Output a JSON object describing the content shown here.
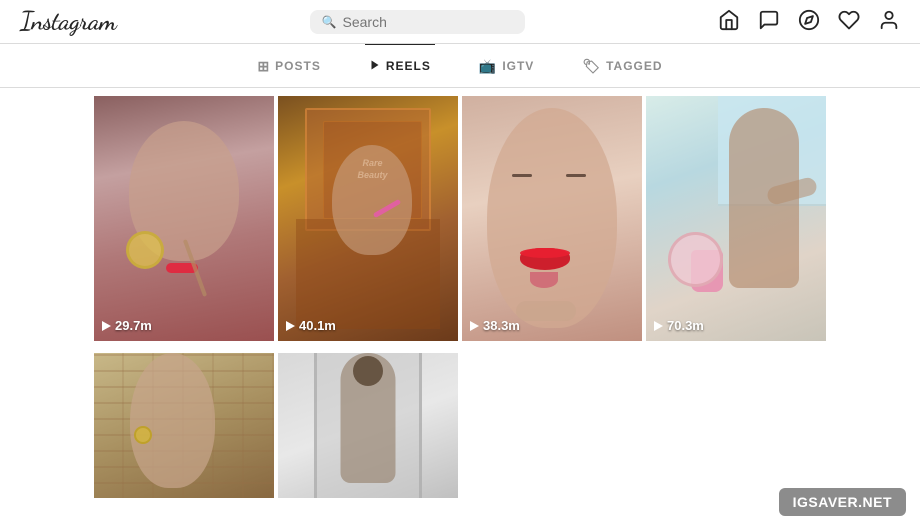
{
  "header": {
    "logo": "Instagram",
    "search": {
      "placeholder": "Search"
    },
    "nav": {
      "home": "🏠",
      "messenger": "💬",
      "compass": "🧭",
      "heart": "♡",
      "profile": "👤"
    }
  },
  "tabs": [
    {
      "id": "posts",
      "label": "POSTS",
      "icon": "⊞",
      "active": false
    },
    {
      "id": "reels",
      "label": "REELS",
      "icon": "▶",
      "active": true
    },
    {
      "id": "igtv",
      "label": "IGTV",
      "icon": "📺",
      "active": false
    },
    {
      "id": "tagged",
      "label": "TAGGED",
      "icon": "🏷",
      "active": false
    }
  ],
  "reels": [
    {
      "id": 1,
      "views": "29.7m",
      "row": 1
    },
    {
      "id": 2,
      "views": "40.1m",
      "row": 1
    },
    {
      "id": 3,
      "views": "38.3m",
      "row": 1
    },
    {
      "id": 4,
      "views": "70.3m",
      "row": 1
    },
    {
      "id": 5,
      "views": "",
      "row": 2
    },
    {
      "id": 6,
      "views": "",
      "row": 2
    }
  ],
  "watermark": {
    "text": "IGSAVER.NET"
  }
}
